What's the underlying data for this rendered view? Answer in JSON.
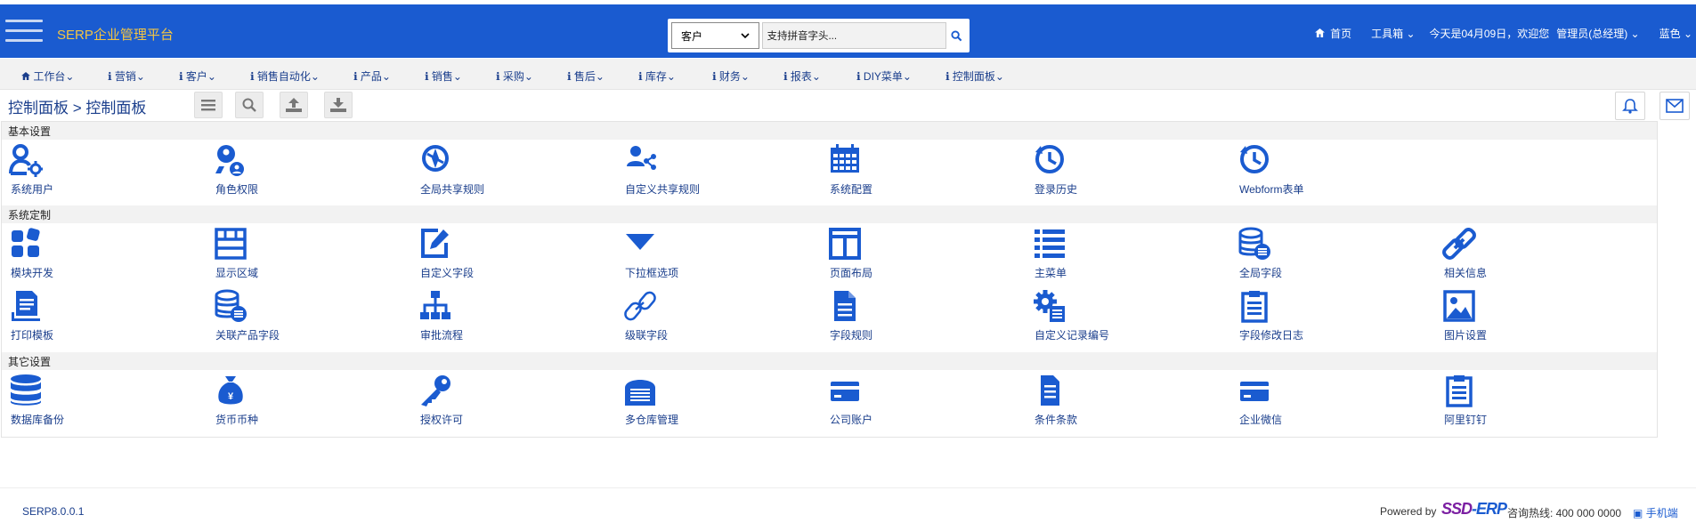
{
  "header": {
    "title": "SERP企业管理平台",
    "search_scope": "客户",
    "search_placeholder": "支持拼音字头...",
    "home": "首页",
    "tools": "工具箱",
    "welcome": "今天是04月09日，欢迎您",
    "user": "管理员(总经理)",
    "theme": "蓝色"
  },
  "nav": [
    "工作台",
    "营销",
    "客户",
    "销售自动化",
    "产品",
    "销售",
    "采购",
    "售后",
    "库存",
    "财务",
    "报表",
    "DIY菜单",
    "控制面板"
  ],
  "breadcrumb": "控制面板 > 控制面板",
  "sections": [
    {
      "title": "基本设置",
      "items": [
        {
          "label": "系统用户",
          "icon": "user-gear-icon"
        },
        {
          "label": "角色权限",
          "icon": "key-user-icon"
        },
        {
          "label": "全局共享规则",
          "icon": "compass-icon"
        },
        {
          "label": "自定义共享规则",
          "icon": "users-share-icon"
        },
        {
          "label": "系统配置",
          "icon": "calendar-grid-icon"
        },
        {
          "label": "登录历史",
          "icon": "history-icon"
        },
        {
          "label": "Webform表单",
          "icon": "history-icon"
        }
      ]
    },
    {
      "title": "系统定制",
      "items": [
        {
          "label": "模块开发",
          "icon": "modules-icon"
        },
        {
          "label": "显示区域",
          "icon": "layout-icon"
        },
        {
          "label": "自定义字段",
          "icon": "edit-icon"
        },
        {
          "label": "下拉框选项",
          "icon": "caret-down-icon"
        },
        {
          "label": "页面布局",
          "icon": "columns-icon"
        },
        {
          "label": "主菜单",
          "icon": "list-icon"
        },
        {
          "label": "全局字段",
          "icon": "database-list-icon"
        },
        {
          "label": "相关信息",
          "icon": "link-icon"
        },
        {
          "label": "打印模板",
          "icon": "print-doc-icon"
        },
        {
          "label": "关联产品字段",
          "icon": "database-list-icon"
        },
        {
          "label": "审批流程",
          "icon": "sitemap-icon"
        },
        {
          "label": "级联字段",
          "icon": "chain-icon"
        },
        {
          "label": "字段规则",
          "icon": "file-icon"
        },
        {
          "label": "自定义记录编号",
          "icon": "gear-doc-icon"
        },
        {
          "label": "字段修改日志",
          "icon": "clipboard-icon"
        },
        {
          "label": "图片设置",
          "icon": "image-icon"
        }
      ]
    },
    {
      "title": "其它设置",
      "items": [
        {
          "label": "数据库备份",
          "icon": "database-icon"
        },
        {
          "label": "货币币种",
          "icon": "money-bag-icon"
        },
        {
          "label": "授权许可",
          "icon": "key-icon"
        },
        {
          "label": "多仓库管理",
          "icon": "warehouse-icon"
        },
        {
          "label": "公司账户",
          "icon": "card-icon"
        },
        {
          "label": "条件条款",
          "icon": "file-text-icon"
        },
        {
          "label": "企业微信",
          "icon": "card-icon"
        },
        {
          "label": "阿里钉钉",
          "icon": "clipboard-icon"
        }
      ]
    }
  ],
  "footer": {
    "version": "SERP8.0.0.1",
    "powered": "Powered by",
    "brand_a": "SSD",
    "brand_b": "-ERP",
    "hotline": "咨询热线: 400 000 0000",
    "mobile": "手机端"
  },
  "colors": {
    "header": "#1a5bd0",
    "accent": "#1a3e8c",
    "title": "#f4c542"
  }
}
